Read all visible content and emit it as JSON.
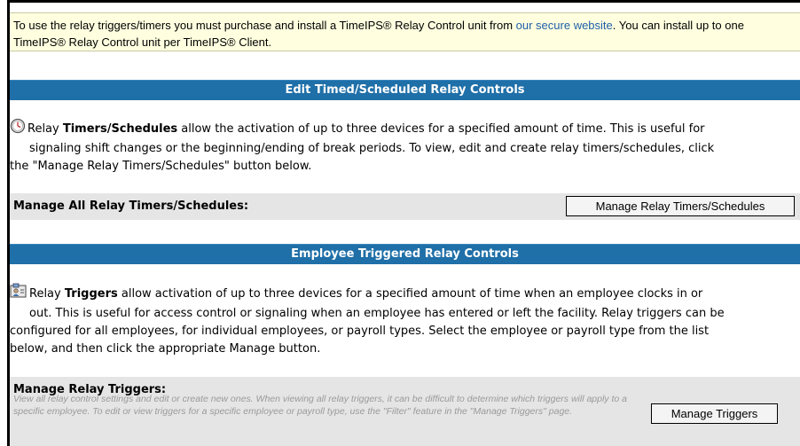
{
  "notice": {
    "text_before_link": "To use the relay triggers/timers you must purchase and install a TimeIPS® Relay Control unit from ",
    "link_text": "our secure website",
    "text_after_link": ". You can install up to one TimeIPS® Relay Control unit per TimeIPS® Client."
  },
  "timers_section": {
    "header": "Edit Timed/Scheduled Relay Controls",
    "icon": "clock-icon",
    "desc_pre": "Relay ",
    "desc_bold": "Timers/Schedules",
    "desc_line1_rest": " allow the activation of up to three devices for a specified amount of time. This is useful for",
    "desc_line2": "signaling shift changes or the beginning/ending of break periods. To view, edit and create relay timers/schedules, click",
    "desc_line3": "the \"Manage Relay Timers/Schedules\" button below.",
    "manage_label": "Manage All Relay Timers/Schedules:",
    "button_label": "Manage Relay Timers/Schedules"
  },
  "triggers_section": {
    "header": "Employee Triggered Relay Controls",
    "icon": "employee-badge-icon",
    "desc_pre": "Relay ",
    "desc_bold": "Triggers",
    "desc_line1_rest": " allow activation of up to three devices for a specified amount of time when an employee clocks in or",
    "desc_line2": "out. This is useful for access control or signaling when an employee has entered or left the facility. Relay triggers can be",
    "desc_line3": "configured for all employees, for individual employees, or payroll types. Select the employee or payroll type from the list",
    "desc_line4": "below, and then click the appropriate Manage button.",
    "manage_label": "Manage Relay Triggers:",
    "help_text": "View all relay control settings and edit or create new ones. When viewing all relay triggers, it can be difficult to determine which triggers will apply to a specific employee. To edit or view triggers for a specific employee or payroll type, use the \"Filter\" feature in the \"Manage Triggers\" page.",
    "button_label": "Manage Triggers"
  },
  "colors": {
    "header_bg": "#1f6fa8",
    "notice_bg": "#ffffe0",
    "link": "#1f5fa8",
    "manage_row_bg": "#e5e5e5"
  }
}
